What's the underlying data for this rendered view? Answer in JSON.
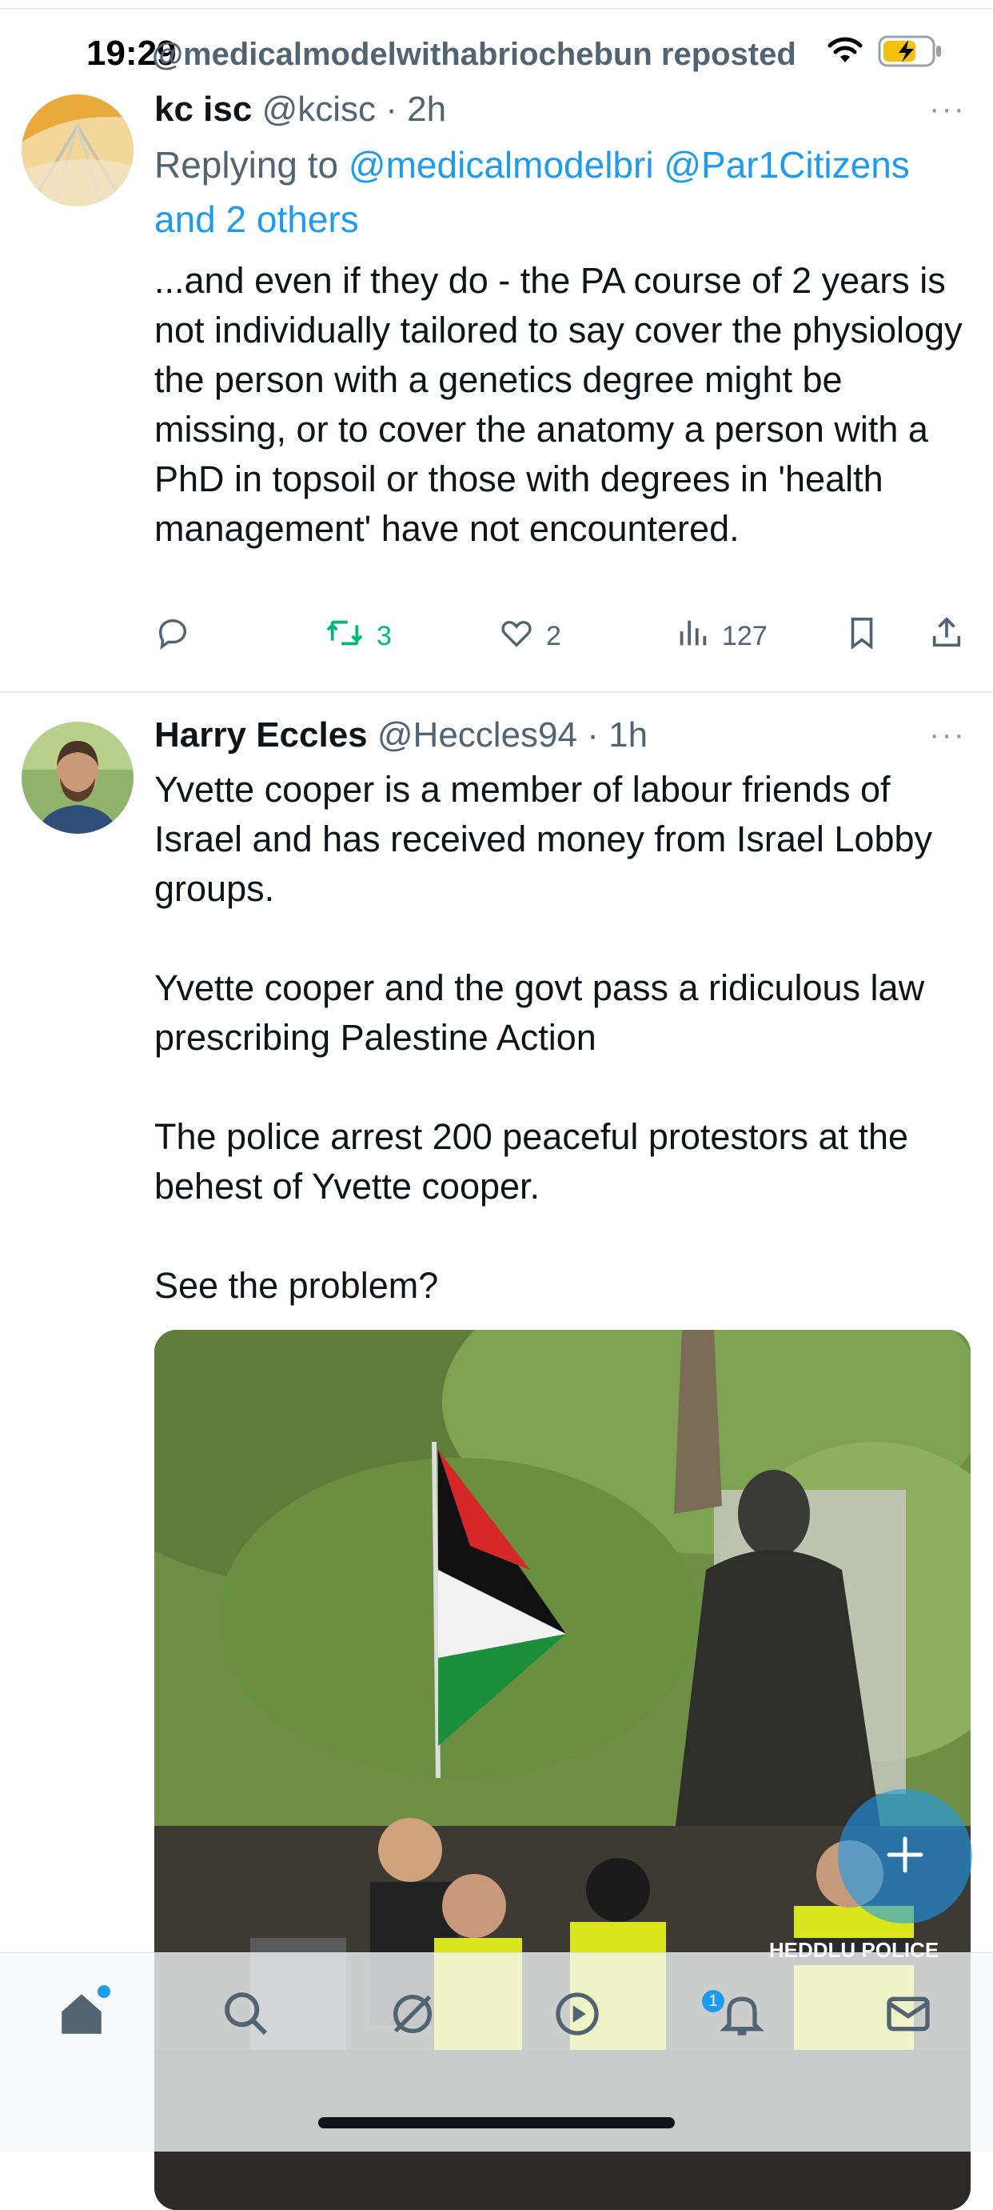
{
  "status_bar": {
    "time": "19:29",
    "repost_text": "@medicalmodelwithabriochebun reposted"
  },
  "tweet1": {
    "name": "kc isc",
    "handle": "@kcisc",
    "time": "· 2h",
    "more": "···",
    "reply_prefix": "Replying to",
    "reply_mentions": "@medicalmodelbri @Par1Citizens and 2 others",
    "text": "...and even if they do - the PA course of 2 years is not individually tailored to say cover the physiology the person with a genetics degree might be missing, or to cover the anatomy a person with a PhD in topsoil or those with degrees in 'health management' have not encountered.",
    "actions": {
      "reply_count": "",
      "retweet_count": "3",
      "like_count": "2",
      "views_count": "127"
    }
  },
  "tweet2": {
    "name": "Harry Eccles",
    "handle": "@Heccles94",
    "time": "· 1h",
    "more": "···",
    "text": "Yvette cooper is a member of labour friends of Israel and has received money from Israel Lobby groups.\n\nYvette cooper and the govt pass a ridiculous law prescribing Palestine Action\n\nThe police arrest 200 peaceful protestors at the behest of Yvette cooper.\n\nSee the problem?",
    "media_text": "HEDDLU POLICE"
  },
  "tabbar": {
    "items": [
      "home-icon",
      "search-icon",
      "grok-icon",
      "communities-icon",
      "notifications-icon",
      "messages-icon"
    ],
    "notification_badge": "1"
  },
  "colors": {
    "accent": "#1d9bf0",
    "retweet_green": "#00ba7c",
    "secondary_text": "#536471",
    "police_yellow": "#d8e61b",
    "flag_red": "#d62828",
    "flag_green": "#1c8f3a"
  }
}
